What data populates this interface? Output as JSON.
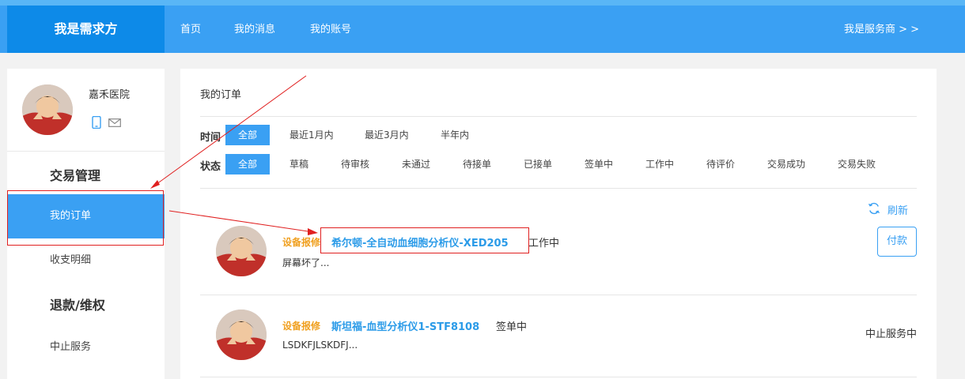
{
  "header": {
    "brand": "我是需求方",
    "nav": [
      "首页",
      "我的消息",
      "我的账号"
    ],
    "switch_role": "我是服务商 > >"
  },
  "sidebar": {
    "user_name": "嘉禾医院",
    "sections": [
      {
        "heading": "交易管理",
        "items": [
          "我的订单",
          "收支明细"
        ]
      },
      {
        "heading": "退款/维权",
        "items": [
          "中止服务"
        ]
      }
    ]
  },
  "main": {
    "title": "我的订单",
    "time_filter": {
      "label": "时间",
      "options": [
        "全部",
        "最近1月内",
        "最近3月内",
        "半年内"
      ]
    },
    "status_filter": {
      "label": "状态",
      "options": [
        "全部",
        "草稿",
        "待审核",
        "未通过",
        "待接单",
        "已接单",
        "签单中",
        "工作中",
        "待评价",
        "交易成功",
        "交易失败"
      ]
    },
    "refresh_label": "刷新",
    "orders": [
      {
        "category": "设备报修",
        "product": "希尔顿-全自动血细胞分析仪-XED205",
        "status": "工作中",
        "description": "屏幕坏了...",
        "action": "付款"
      },
      {
        "category": "设备报修",
        "product": "斯坦福-血型分析仪1-STF8108",
        "status": "签单中",
        "description": "LSDKFJLSKDFJ...",
        "state": "中止服务中"
      }
    ]
  },
  "colors": {
    "header_bg": "#3aa0f3",
    "brand_bg": "#0d8ae8",
    "accent": "#3aa0f3",
    "category": "#f0a020",
    "annotation": "#e02020"
  }
}
